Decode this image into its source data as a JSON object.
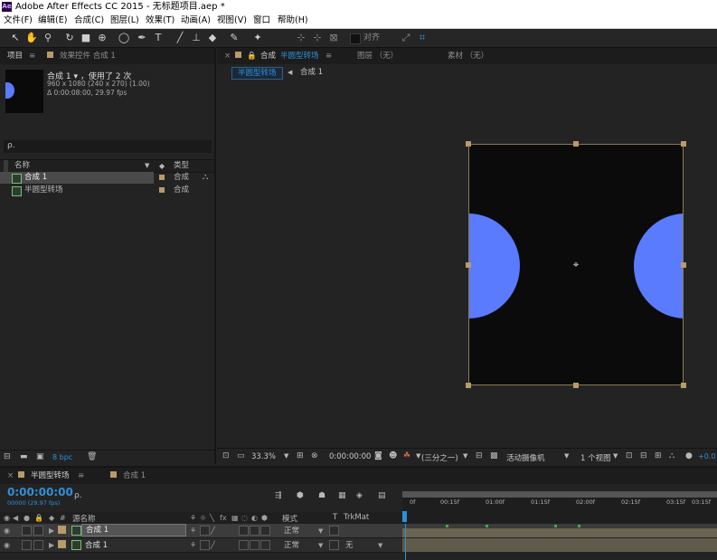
{
  "window": {
    "app_icon": "Ae",
    "title": "Adobe After Effects CC 2015 - 无标题项目.aep *"
  },
  "menu": [
    "文件(F)",
    "编辑(E)",
    "合成(C)",
    "图层(L)",
    "效果(T)",
    "动画(A)",
    "视图(V)",
    "窗口",
    "帮助(H)"
  ],
  "toolbar": {
    "tools": [
      "selection-tool-icon",
      "hand-tool-icon",
      "zoom-tool-icon",
      "rotate-tool-icon",
      "camera-tool-icon",
      "pan-behind-tool-icon",
      "ellipse-tool-icon",
      "pen-tool-icon",
      "type-tool-icon",
      "brush-tool-icon",
      "clone-stamp-tool-icon",
      "eraser-tool-icon",
      "roto-brush-tool-icon",
      "puppet-tool-icon"
    ],
    "align_label": "对齐"
  },
  "project_panel": {
    "tab_label": "项目",
    "tab_menu": "≡",
    "effects_tab_label": "效果控件 合成 1",
    "comp_name": "合成 1",
    "used_label": "▾ ，使用了 2 次",
    "dimensions": "960 x 1080  (240 x 270) (1.00)",
    "duration": "Δ 0:00:08:00, 29.97 fps",
    "search_icon": "ρ.",
    "col_name": "名称",
    "col_type": "类型",
    "items": [
      {
        "name": "合成 1",
        "type": "合成"
      },
      {
        "name": "半圆型转场",
        "type": "合成"
      }
    ],
    "bpc": "8 bpc"
  },
  "comp_panel": {
    "tab_label": "合成",
    "tab_comp_name": "半圆型转场",
    "tab_menu": "≡",
    "layer_tab": "图层 （无）",
    "footage_tab": "素材 （无）",
    "breadcrumb_active": "半圆型转场",
    "breadcrumb_next": "合成 1",
    "zoom": "33.3%",
    "timecode": "0:00:00:00",
    "resolution": "(三分之一)",
    "camera": "活动摄像机",
    "views": "1 个视图",
    "exposure": "+0.0",
    "shape_color": "#5b7bff"
  },
  "timeline": {
    "tab_active": "半圆型转场",
    "tab_menu": "≡",
    "tab_other": "合成 1",
    "timecode": "0:00:00:00",
    "frame_info": "00000 (29.97 fps)",
    "search_icon": "ρ.",
    "col_source": "源名称",
    "col_mode": "模式",
    "col_t": "T",
    "col_trkmat": "TrkMat",
    "ruler": [
      "0f",
      "00:15f",
      "01:00f",
      "01:15f",
      "02:00f",
      "02:15f",
      "03:15f",
      "03:15f"
    ],
    "layers": [
      {
        "index": "1",
        "name": "合成 1",
        "mode": "正常",
        "trkmat": ""
      },
      {
        "index": "2",
        "name": "合成 1",
        "mode": "正常",
        "trkmat": "无"
      }
    ]
  }
}
